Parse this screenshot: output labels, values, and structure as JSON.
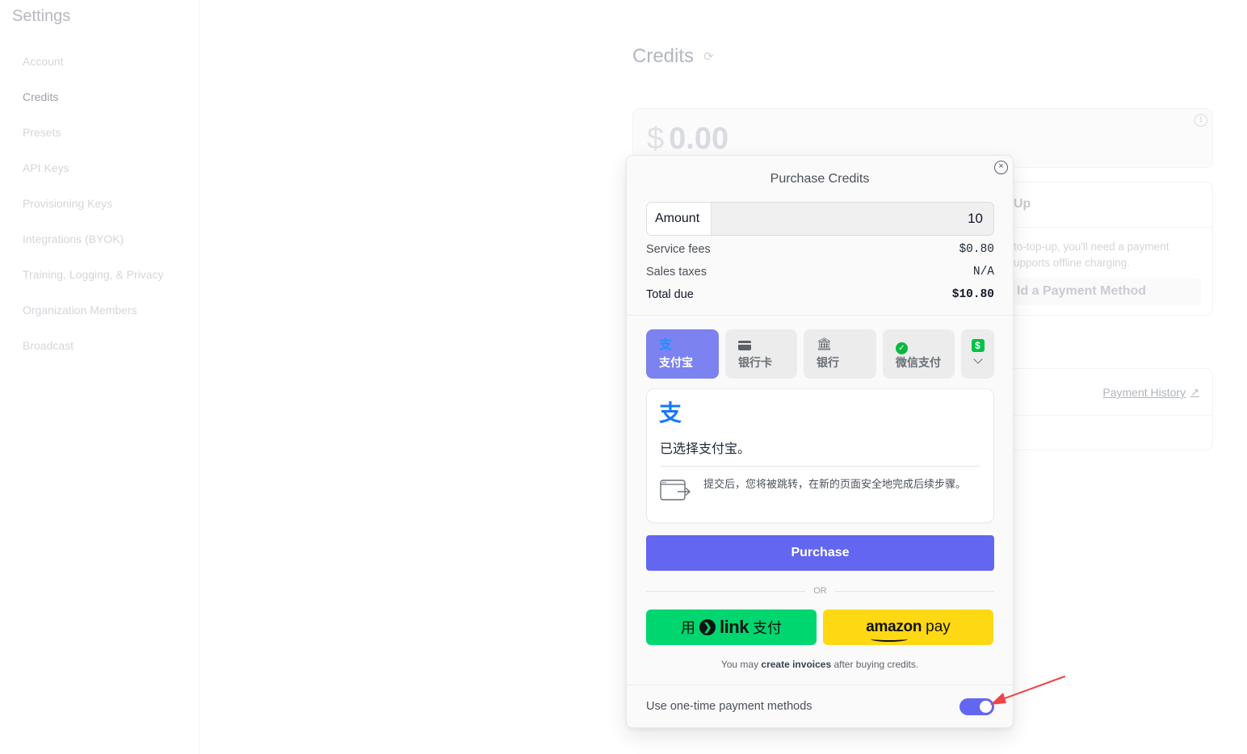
{
  "page": {
    "settings_title": "Settings",
    "nav": [
      {
        "label": "Account"
      },
      {
        "label": "Credits"
      },
      {
        "label": "Presets"
      },
      {
        "label": "API Keys"
      },
      {
        "label": "Provisioning Keys"
      },
      {
        "label": "Integrations (BYOK)"
      },
      {
        "label": "Training, Logging, & Privacy"
      },
      {
        "label": "Organization Members"
      },
      {
        "label": "Broadcast"
      }
    ],
    "active_nav": "Credits",
    "credits_title": "Credits",
    "balance": {
      "currency": "$",
      "amount": "0.00"
    },
    "auto_topup": {
      "heading": "Up",
      "desc": "to-top-up, you'll need a payment upports offline charging.",
      "button": "ld a Payment Method"
    },
    "payment_history_label": "Payment History"
  },
  "modal": {
    "title": "Purchase Credits",
    "amount_label": "Amount",
    "amount_value": "10",
    "fees": {
      "service_label": "Service fees",
      "service_value": "$0.80",
      "tax_label": "Sales taxes",
      "tax_value": "N/A",
      "total_label": "Total due",
      "total_value": "$10.80"
    },
    "payment_tabs": [
      {
        "label": "支付宝",
        "icon": "alipay-icon",
        "active": true
      },
      {
        "label": "银行卡",
        "icon": "card-icon",
        "active": false
      },
      {
        "label": "银行",
        "icon": "bank-icon",
        "active": false
      },
      {
        "label": "微信支付",
        "icon": "wechat-icon",
        "active": false
      }
    ],
    "panel": {
      "logo_glyph": "支",
      "selected_text": "已选择支付宝。",
      "redirect_note": "提交后，您将被跳转，在新的页面安全地完成后续步骤。"
    },
    "purchase_label": "Purchase",
    "or_label": "OR",
    "link_pay": {
      "prefix": "用",
      "brand": "link",
      "suffix": "支付"
    },
    "amazon_pay": {
      "brand": "amazon",
      "suffix": "pay"
    },
    "invoice_note": {
      "pre": "You may ",
      "bold": "create invoices",
      "post": " after buying credits."
    },
    "one_time_label": "Use one-time payment methods",
    "one_time_enabled": true
  },
  "colors": {
    "accent": "#6366f1",
    "active_tab": "#7c82f0",
    "link_green": "#00d66f",
    "amazon_yellow": "#ffd814",
    "alipay_blue": "#1677ff",
    "annotation_red": "#ef4444"
  }
}
